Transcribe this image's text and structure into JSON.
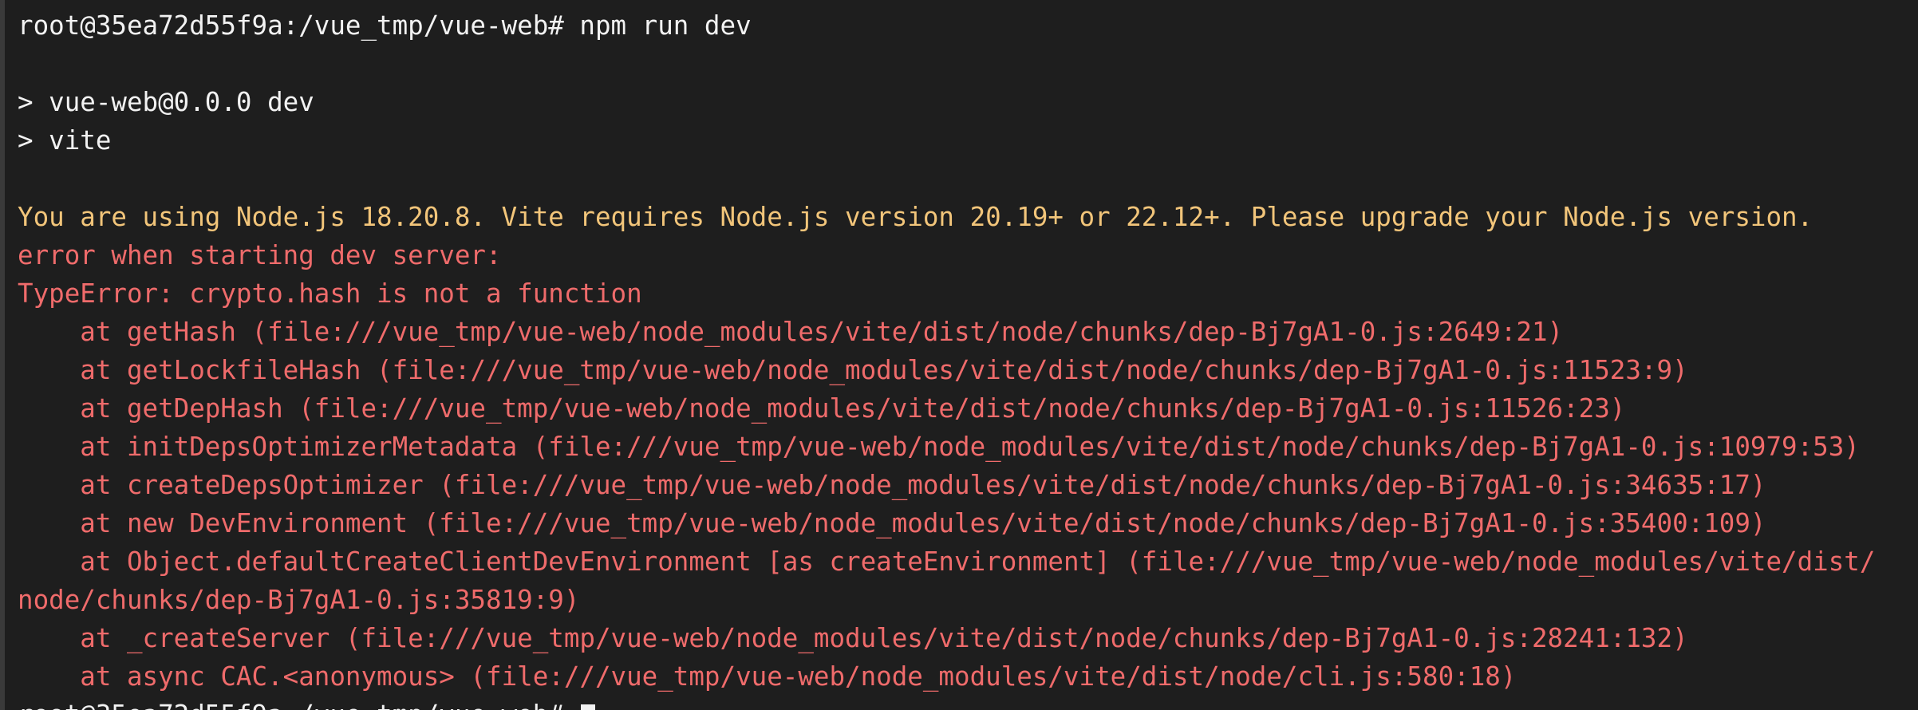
{
  "terminal": {
    "prompt_command": "root@35ea72d55f9a:/vue_tmp/vue-web# npm run dev",
    "script_name": "> vue-web@0.0.0 dev",
    "script_cmd": "> vite",
    "warning": "You are using Node.js 18.20.8. Vite requires Node.js version 20.19+ or 22.12+. Please upgrade your Node.js version.",
    "error_start": "error when starting dev server:",
    "type_error": "TypeError: crypto.hash is not a function",
    "stack": [
      "    at getHash (file:///vue_tmp/vue-web/node_modules/vite/dist/node/chunks/dep-Bj7gA1-0.js:2649:21)",
      "    at getLockfileHash (file:///vue_tmp/vue-web/node_modules/vite/dist/node/chunks/dep-Bj7gA1-0.js:11523:9)",
      "    at getDepHash (file:///vue_tmp/vue-web/node_modules/vite/dist/node/chunks/dep-Bj7gA1-0.js:11526:23)",
      "    at initDepsOptimizerMetadata (file:///vue_tmp/vue-web/node_modules/vite/dist/node/chunks/dep-Bj7gA1-0.js:10979:53)",
      "    at createDepsOptimizer (file:///vue_tmp/vue-web/node_modules/vite/dist/node/chunks/dep-Bj7gA1-0.js:34635:17)",
      "    at new DevEnvironment (file:///vue_tmp/vue-web/node_modules/vite/dist/node/chunks/dep-Bj7gA1-0.js:35400:109)",
      "    at Object.defaultCreateClientDevEnvironment [as createEnvironment] (file:///vue_tmp/vue-web/node_modules/vite/dist/",
      "node/chunks/dep-Bj7gA1-0.js:35819:9)",
      "    at _createServer (file:///vue_tmp/vue-web/node_modules/vite/dist/node/chunks/dep-Bj7gA1-0.js:28241:132)",
      "    at async CAC.<anonymous> (file:///vue_tmp/vue-web/node_modules/vite/dist/node/cli.js:580:18)"
    ],
    "final_prompt": "root@35ea72d55f9a:/vue_tmp/vue-web# "
  },
  "colors": {
    "background": "#1e1e1e",
    "text": "#f2f2f2",
    "warning": "#f2c57a",
    "error": "#ef6b6b"
  }
}
